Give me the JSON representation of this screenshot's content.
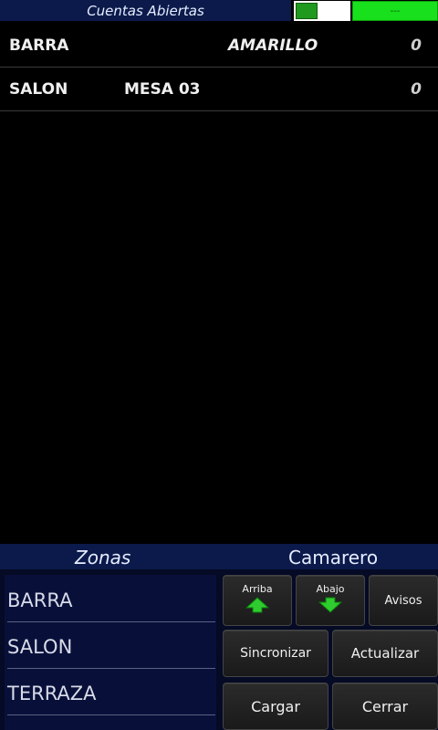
{
  "header": {
    "title": "Cuentas Abiertas",
    "status_text": "---"
  },
  "accounts": [
    {
      "zone": "BARRA",
      "table": "",
      "waiter": "AMARILLO",
      "amount": "0"
    },
    {
      "zone": "SALON",
      "table": "MESA 03",
      "waiter": "",
      "amount": "0"
    }
  ],
  "sections": {
    "zonas": "Zonas",
    "camarero": "Camarero"
  },
  "zones": [
    "BARRA",
    "SALON",
    "TERRAZA"
  ],
  "buttons": {
    "arriba": "Arriba",
    "abajo": "Abajo",
    "avisos": "Avisos",
    "sincronizar": "Sincronizar",
    "actualizar": "Actualizar",
    "cargar": "Cargar",
    "cerrar": "Cerrar"
  },
  "colors": {
    "header_bg": "#0b1a4a",
    "status_green": "#18e01c",
    "arrow_green": "#2ecc2e"
  }
}
